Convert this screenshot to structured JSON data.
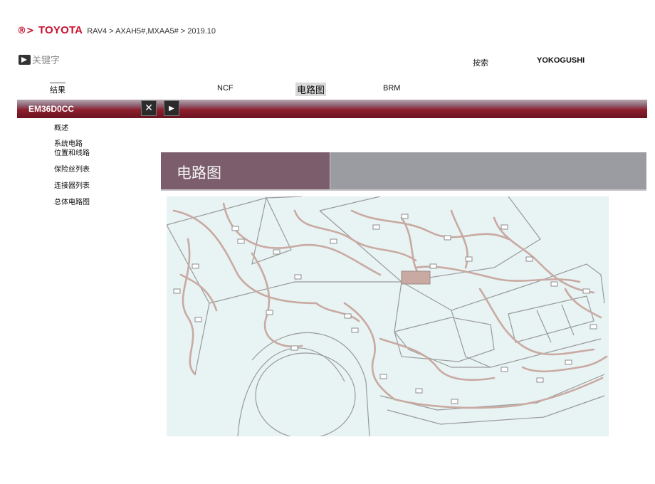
{
  "header": {
    "brand_mark": "®>",
    "brand": "TOYOTA",
    "breadcrumb": "RAV4 > AXAH5#,MXAA5# > 2019.10"
  },
  "keyword": {
    "label": "关键字",
    "icon": "arrow-right-icon"
  },
  "search": {
    "label": "按索",
    "value": "YOKOGUSHI"
  },
  "tabs": {
    "results": "结果",
    "ncf": "NCF",
    "diagram": "电路图",
    "brm": "BRM"
  },
  "bar": {
    "code": "EM36D0CC",
    "close_icon": "close-icon",
    "next_icon": "play-icon",
    "close_symbol": "✕",
    "next_symbol": "▶"
  },
  "menu": {
    "items": [
      "概述",
      "系统电路",
      "位置和线路",
      "保险丝列表",
      "连接器列表",
      "总体电路图"
    ]
  },
  "content": {
    "title": "电路图"
  },
  "colors": {
    "brand_red": "#c8102e",
    "bar_red": "#8d1f2e",
    "banner_mauve": "#7c5d6c",
    "banner_gray": "#9a9ca2",
    "wire": "#c9aaa2",
    "diagram_bg": "#e8f3f3"
  }
}
